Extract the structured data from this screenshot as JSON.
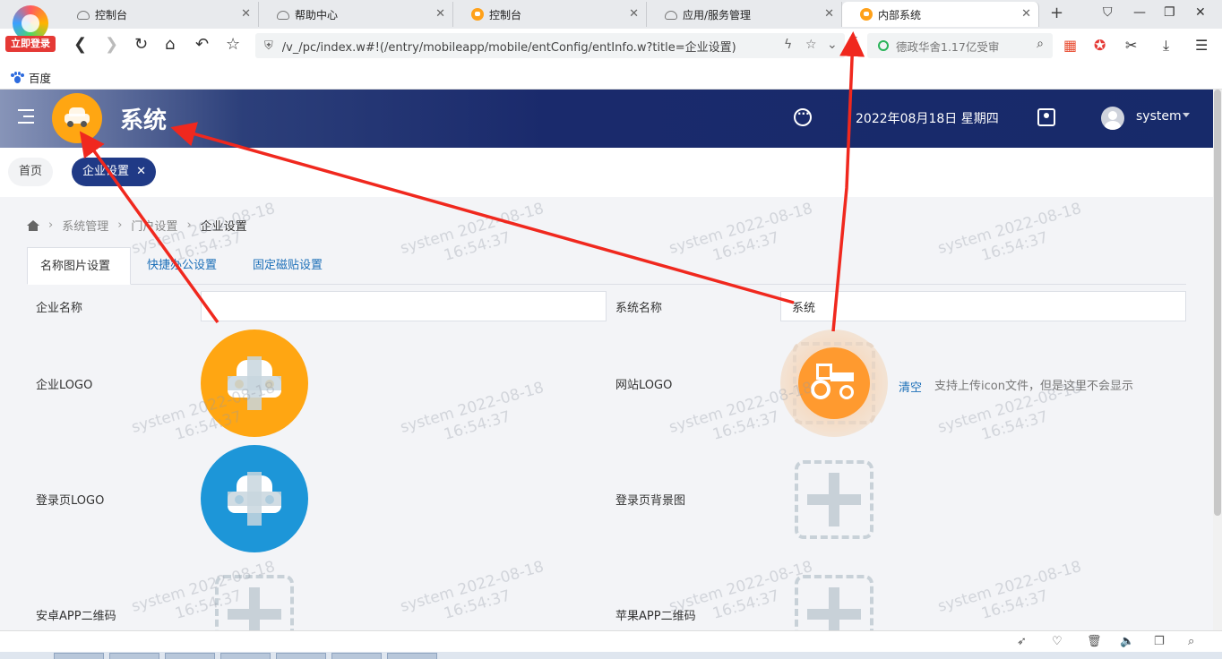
{
  "browser": {
    "login_badge": "立即登录",
    "tabs": [
      {
        "label": "控制台",
        "favicon": "cloud-icon"
      },
      {
        "label": "帮助中心",
        "favicon": "cloud-icon"
      },
      {
        "label": "控制台",
        "favicon": "orange-app-icon"
      },
      {
        "label": "应用/服务管理",
        "favicon": "cloud-icon"
      },
      {
        "label": "内部系统",
        "favicon": "orange-app-icon",
        "active": true
      }
    ],
    "url": "/v_/pc/index.w#!(/entry/mobileapp/mobile/entConfig/entInfo.w?title=企业设置)",
    "search_text": "德政华舍1.17亿受审",
    "bookmark": "百度"
  },
  "header": {
    "title": "系统",
    "date": "2022年08月18日 星期四",
    "username": "system",
    "color": "#172a6a"
  },
  "page_tabs": {
    "home": "首页",
    "active": "企业设置"
  },
  "breadcrumb": {
    "items": [
      "系统管理",
      "门户设置",
      "企业设置"
    ]
  },
  "content_tabs": [
    "名称图片设置",
    "快捷办公设置",
    "固定磁贴设置"
  ],
  "form": {
    "company_name_label": "企业名称",
    "company_name_value": "",
    "system_name_label": "系统名称",
    "system_name_value": "系统",
    "company_logo_label": "企业LOGO",
    "site_logo_label": "网站LOGO",
    "login_logo_label": "登录页LOGO",
    "login_bg_label": "登录页背景图",
    "android_qr_label": "安卓APP二维码",
    "ios_qr_label": "苹果APP二维码",
    "clear_label": "清空",
    "site_logo_hint": "支持上传icon文件，但是这里不会显示"
  },
  "colors": {
    "accent_blue": "#203a86",
    "logo_orange": "#ffa612",
    "logo_blue": "#1d96d8",
    "link": "#1c6fb8",
    "annotation_red": "#f0281e"
  },
  "watermark": {
    "line1": "system 2022-08-18",
    "line2": "16:54:37"
  }
}
